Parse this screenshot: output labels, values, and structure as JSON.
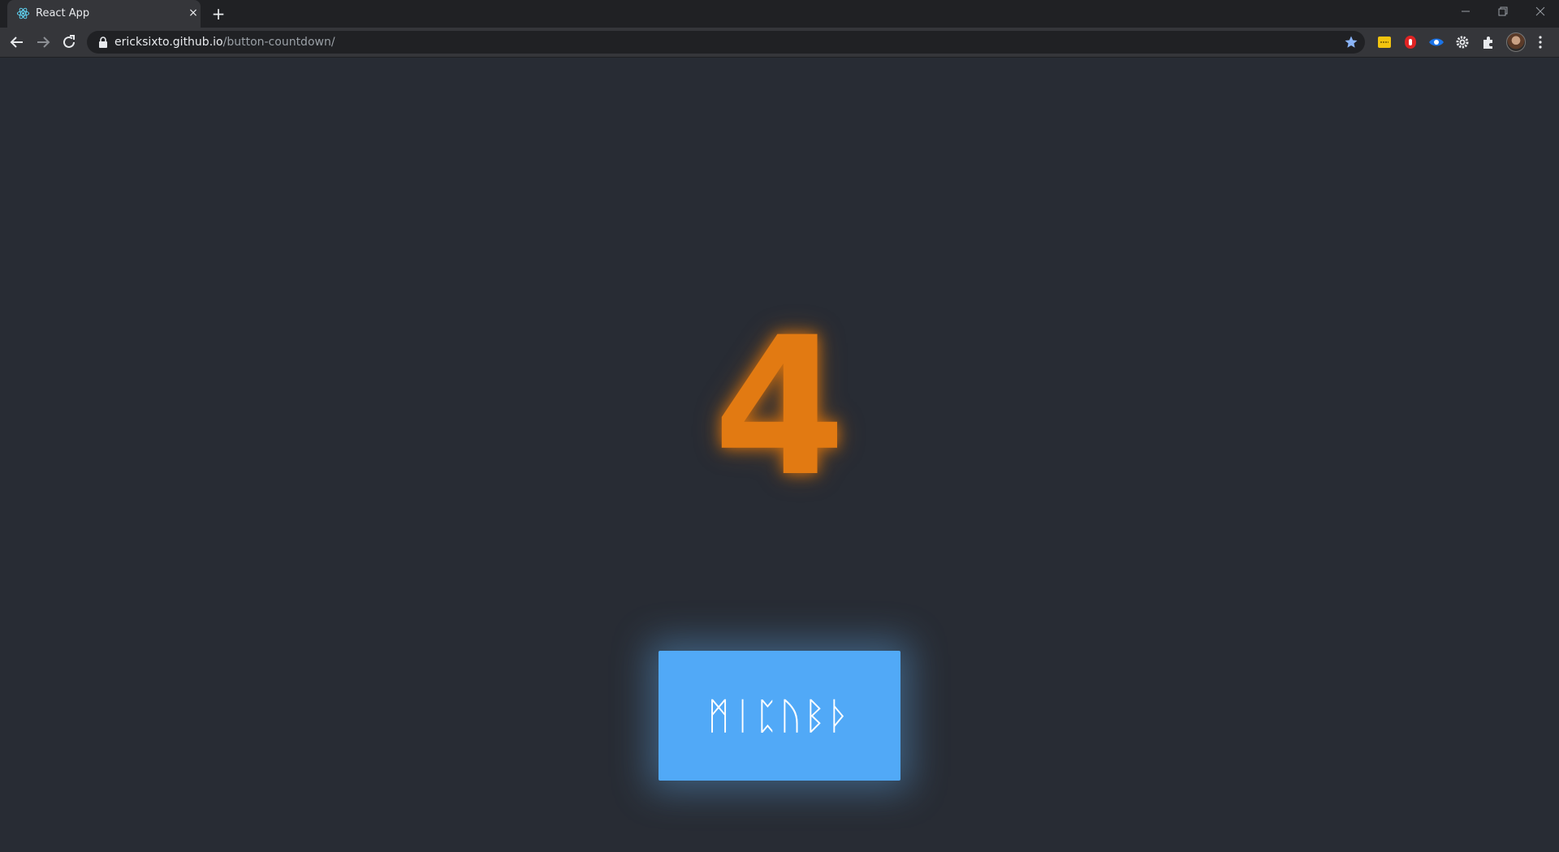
{
  "browser": {
    "tab_title": "React App",
    "tab_close": "×",
    "new_tab": "+",
    "url_host": "ericksixto.github.io",
    "url_path": "/button-countdown/",
    "window_controls": {
      "minimize": "–",
      "restore": "❐",
      "close": "✕"
    },
    "icons": {
      "favicon": "react-atom-icon",
      "back": "arrow-left-icon",
      "forward": "arrow-right-icon",
      "reload": "reload-icon",
      "lock": "lock-icon",
      "bookmark": "star-icon",
      "extensions": [
        "yellow-note-extension-icon",
        "red-hand-extension-icon",
        "blue-eye-extension-icon",
        "gear-extension-icon",
        "puzzle-extensions-icon"
      ],
      "profile": "profile-avatar",
      "menu": "three-dots-menu-icon"
    },
    "colors": {
      "tab_strip": "#202124",
      "toolbar": "#35363a",
      "star": "#8ab4f8"
    }
  },
  "app": {
    "countdown_value": "4",
    "button_label": "ᛗᛁᛈᚢᛒᚦ",
    "colors": {
      "background": "#282c34",
      "countdown": "#e27a12",
      "button": "#51a9f7",
      "button_text": "#ffffff"
    }
  }
}
